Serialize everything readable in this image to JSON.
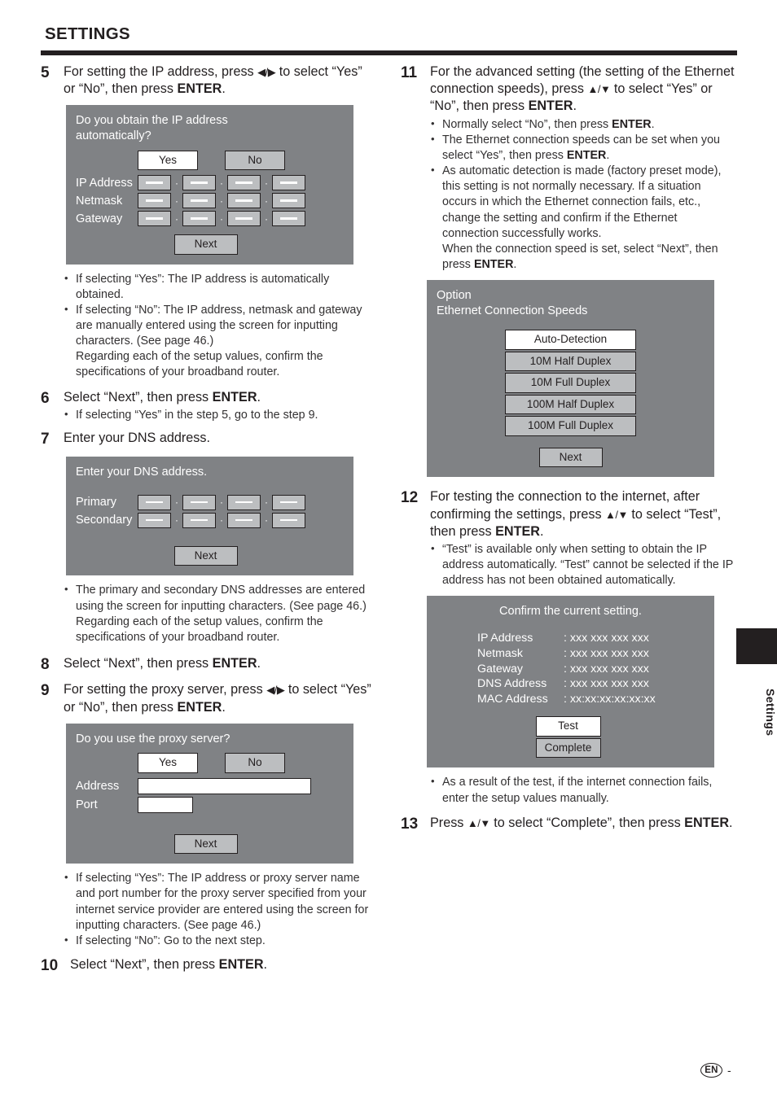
{
  "header": {
    "title": "SETTINGS"
  },
  "left_column": {
    "steps": [
      {
        "num": "5",
        "text_parts": {
          "a": "For setting the IP address, press ",
          "arrows": "◀/▶",
          "b": " to select “Yes” or “No”, then press ",
          "bold": "ENTER",
          "c": "."
        }
      },
      {
        "num": "6",
        "text": "Select “Next”, then press ",
        "bold": "ENTER",
        "tail": ".",
        "bullets": [
          "If selecting “Yes” in the step 5, go to the step 9."
        ]
      },
      {
        "num": "7",
        "text": "Enter your DNS address."
      },
      {
        "num": "8",
        "text": "Select “Next”, then press ",
        "bold": "ENTER",
        "tail": "."
      },
      {
        "num": "9",
        "text_parts": {
          "a": "For setting the proxy server, press ",
          "arrows": "◀/▶",
          "b": " to select “Yes” or “No”, then press ",
          "bold": "ENTER",
          "c": "."
        }
      },
      {
        "num": "10",
        "text": "Select “Next”, then press ",
        "bold": "ENTER",
        "tail": "."
      }
    ],
    "ip_dialog": {
      "title_line1": "Do you obtain the IP address",
      "title_line2": "automatically?",
      "yes_label": "Yes",
      "no_label": "No",
      "yes_selected": true,
      "rows": [
        {
          "label": "IP Address",
          "octets": [
            "—",
            "—",
            "—",
            "—"
          ]
        },
        {
          "label": "Netmask",
          "octets": [
            "—",
            "—",
            "—",
            "—"
          ]
        },
        {
          "label": "Gateway",
          "octets": [
            "—",
            "—",
            "—",
            "—"
          ]
        }
      ],
      "separator": "·",
      "next_label": "Next"
    },
    "ip_notes": [
      "If selecting “Yes”: The IP address is automatically obtained.",
      "If selecting “No”: The IP address, netmask and gateway are manually entered using the screen for inputting characters. (See page 46.)",
      "Regarding each of the setup values, confirm the specifications of your broadband router."
    ],
    "dns_dialog": {
      "title": "Enter your DNS address.",
      "rows": [
        {
          "label": "Primary",
          "octets": [
            "—",
            "—",
            "—",
            "—"
          ]
        },
        {
          "label": "Secondary",
          "octets": [
            "—",
            "—",
            "—",
            "—"
          ]
        }
      ],
      "separator": "·",
      "next_label": "Next"
    },
    "dns_notes": [
      "The primary and secondary DNS addresses are entered using the screen for inputting characters. (See page 46.)",
      "Regarding each of the setup values, confirm the specifications of your broadband router."
    ],
    "proxy_dialog": {
      "title": "Do you use the proxy server?",
      "yes_label": "Yes",
      "no_label": "No",
      "yes_selected": true,
      "address_label": "Address",
      "address_value": "",
      "port_label": "Port",
      "port_value": "",
      "next_label": "Next"
    },
    "proxy_notes": [
      "If selecting “Yes”: The IP address or proxy server name and port number for the proxy server specified from your internet service provider are entered using the screen for inputting characters. (See page 46.)",
      "If selecting “No”: Go to the next step."
    ]
  },
  "right_column": {
    "step11": {
      "num": "11",
      "a": "For the advanced setting (the setting of the Ethernet connection speeds), press ",
      "arrows": "▲/▼",
      "b": " to select “Yes” or “No”, then press ",
      "bold": "ENTER",
      "c": ".",
      "bullets": [
        {
          "pre": "Normally select “No”, then press ",
          "bold": "ENTER",
          "post": "."
        },
        {
          "pre": "The Ethernet connection speeds can be set when you select “Yes”, then press ",
          "bold": "ENTER",
          "post": "."
        },
        {
          "pre": "As automatic detection is made (factory preset mode), this setting is not normally necessary. If a situation occurs in which the Ethernet connection fails, etc., change the setting and confirm if the Ethernet connection successfully works.",
          "sub_pre": "When the connection speed is set, select “Next”, then press ",
          "bold": "ENTER",
          "post": "."
        }
      ]
    },
    "option_dialog": {
      "title_line1": "Option",
      "title_line2": "Ethernet Connection Speeds",
      "options": [
        {
          "label": "Auto-Detection",
          "selected": true
        },
        {
          "label": "10M Half Duplex",
          "selected": false
        },
        {
          "label": "10M Full Duplex",
          "selected": false
        },
        {
          "label": "100M Half Duplex",
          "selected": false
        },
        {
          "label": "100M Full Duplex",
          "selected": false
        }
      ],
      "next_label": "Next"
    },
    "step12": {
      "num": "12",
      "a": "For testing the connection to the internet, after confirming the settings, press ",
      "arrows": "▲/▼",
      "b": " to select “Test”, then press ",
      "bold": "ENTER",
      "c": ".",
      "bullets": [
        "“Test” is available only when setting to obtain the IP address automatically. “Test” cannot be selected if the IP address has not been obtained automatically."
      ]
    },
    "confirm_dialog": {
      "title": "Confirm the current setting.",
      "rows": [
        {
          "label": "IP Address",
          "value": ": xxx xxx xxx xxx"
        },
        {
          "label": "Netmask",
          "value": ": xxx xxx xxx xxx"
        },
        {
          "label": "Gateway",
          "value": ": xxx xxx xxx xxx"
        },
        {
          "label": "DNS Address",
          "value": ": xxx xxx xxx xxx"
        },
        {
          "label": "MAC Address",
          "value": ": xx:xx:xx:xx:xx:xx"
        }
      ],
      "test_label": "Test",
      "complete_label": "Complete",
      "test_selected": true
    },
    "after_confirm_notes": [
      "As a result of the test, if the internet connection fails, enter the setup values manually."
    ],
    "step13": {
      "num": "13",
      "a": "Press ",
      "arrows": "▲/▼",
      "b": " to select “Complete”, then press ",
      "bold": "ENTER",
      "c": "."
    }
  },
  "edge_tab": {
    "label": "Settings"
  },
  "footer": {
    "lang": "EN",
    "page_dash": "-"
  },
  "colors": {
    "ink": "#231f20",
    "dialog_bg": "#808285",
    "button_unselected": "#bcbec0",
    "button_selected": "#ffffff",
    "body_text": "#333132"
  }
}
